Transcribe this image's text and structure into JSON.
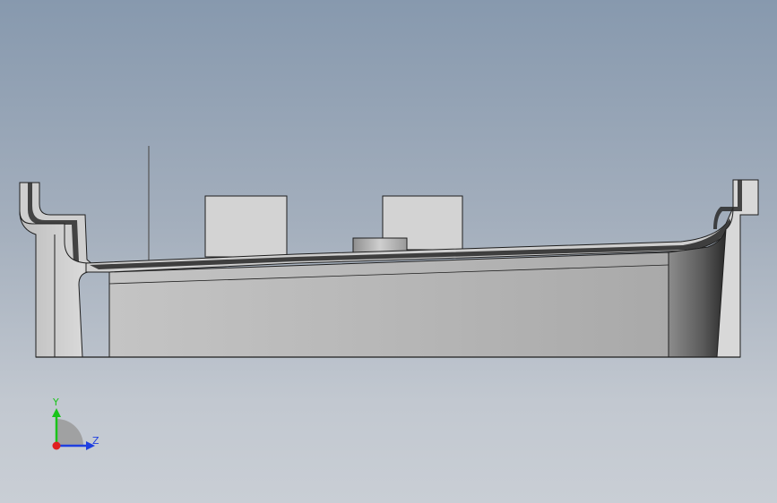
{
  "viewport": {
    "background_top": "#8799ae",
    "background_bottom": "#c9ced5"
  },
  "model": {
    "outline_color": "#1e1e1e",
    "body_color": "#b4b4b4",
    "shade_light": "#d8d8d8",
    "shade_dark": "#3a3a3a"
  },
  "triad": {
    "y_label": "Y",
    "z_label": "Z",
    "y_color": "#19c419",
    "z_color": "#1f3fe0",
    "x_color": "#e01f1f"
  }
}
